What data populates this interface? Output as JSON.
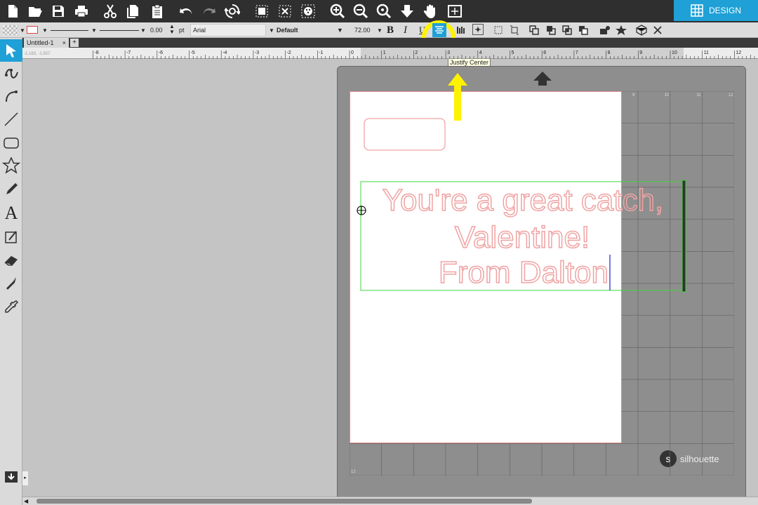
{
  "app": {
    "design_tab_label": "DESIGN",
    "document_tab": "Untitled-1"
  },
  "text_toolbar": {
    "line_weight": "0.00",
    "line_unit": "pt",
    "font_name": "Arial",
    "font_style": "Default",
    "font_size": "72.00",
    "bold": "B",
    "italic": "I",
    "underline": "U"
  },
  "tooltip": "Justify Center",
  "ruler": {
    "labels": [
      "-8",
      "-7",
      "-6",
      "-5",
      "-4",
      "-3",
      "-2",
      "-1",
      "0",
      "1",
      "2",
      "3",
      "4",
      "5",
      "6",
      "7",
      "8",
      "9",
      "10",
      "11",
      "12"
    ],
    "readout": "-1.183, -1.557"
  },
  "mat": {
    "brand": "silhouette",
    "grid_labels": [
      "9",
      "10",
      "11",
      "12"
    ],
    "corner_label": "12"
  },
  "canvas_text": {
    "line1": "You're a great catch,",
    "line2": "Valentine!",
    "line3": "From Dalton"
  },
  "colors": {
    "accent": "#1fa0d6",
    "highlight": "#fff200",
    "cut_line": "#f0a3a3",
    "selection": "#3fd63f"
  }
}
